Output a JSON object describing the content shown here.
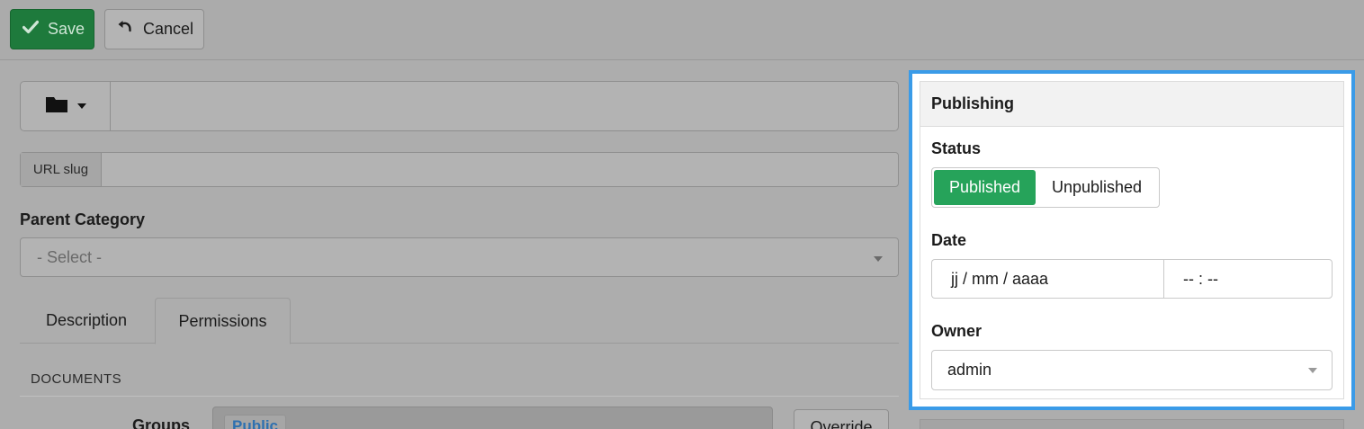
{
  "toolbar": {
    "save_label": "Save",
    "cancel_label": "Cancel"
  },
  "form": {
    "title_value": "",
    "url_slug_label": "URL slug",
    "url_slug_value": "",
    "parent_category_label": "Parent Category",
    "parent_category_value": "- Select -"
  },
  "tabs": [
    {
      "label": "Description",
      "active": false
    },
    {
      "label": "Permissions",
      "active": true
    }
  ],
  "permissions": {
    "section_label": "DOCUMENTS",
    "groups_label": "Groups",
    "groups": [
      "Public"
    ],
    "override_label": "Override"
  },
  "publishing": {
    "title": "Publishing",
    "status_label": "Status",
    "status_options": [
      "Published",
      "Unpublished"
    ],
    "status_selected": "Published",
    "date_label": "Date",
    "date_placeholder": "jj / mm / aaaa",
    "time_placeholder": "-- : --",
    "owner_label": "Owner",
    "owner_value": "admin"
  },
  "colors": {
    "accent_highlight": "#3a9be8",
    "published_green": "#26a35a",
    "save_green": "#1e7a3c"
  },
  "icons": {
    "save": "check-icon",
    "cancel": "undo-icon",
    "folder": "folder-icon",
    "dropdown": "caret-down-icon"
  }
}
